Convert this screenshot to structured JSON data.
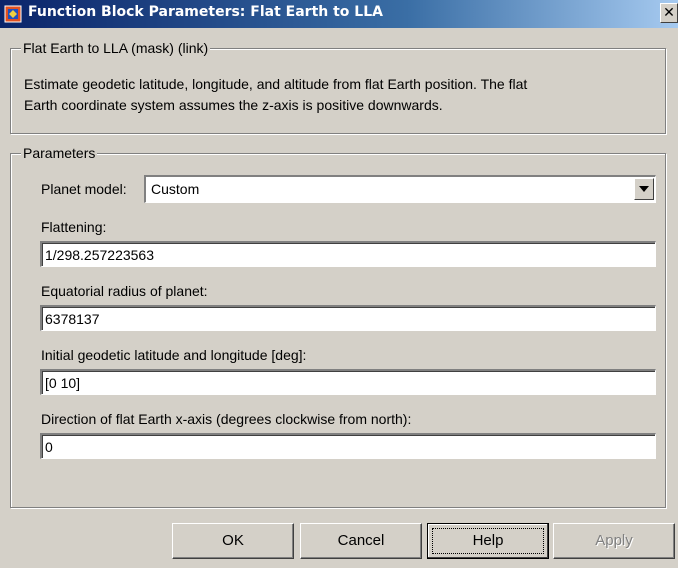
{
  "window": {
    "title": "Function Block Parameters: Flat Earth to LLA",
    "close_glyph": "✕"
  },
  "block": {
    "group_title": "Flat Earth to LLA (mask) (link)",
    "description_line1": "Estimate geodetic latitude, longitude, and altitude from flat Earth position.  The flat",
    "description_line2": "Earth coordinate system assumes the z-axis is positive downwards."
  },
  "parameters": {
    "group_title": "Parameters",
    "planet_model": {
      "label": "Planet model:",
      "value": "Custom"
    },
    "flattening": {
      "label": "Flattening:",
      "value": "1/298.257223563"
    },
    "equatorial_radius": {
      "label": "Equatorial radius of planet:",
      "value": "6378137"
    },
    "initial_lat_lon": {
      "label": "Initial geodetic latitude and longitude [deg]:",
      "value": "[0 10]"
    },
    "direction_x_axis": {
      "label": "Direction of flat Earth x-axis (degrees clockwise from north):",
      "value": "0"
    }
  },
  "buttons": {
    "ok": "OK",
    "cancel": "Cancel",
    "help": "Help",
    "apply": "Apply"
  }
}
